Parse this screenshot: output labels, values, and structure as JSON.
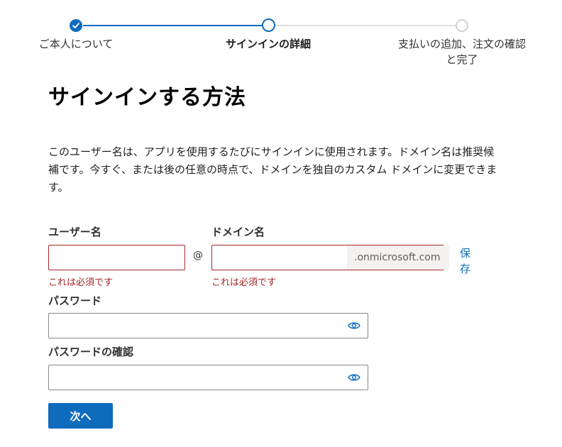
{
  "stepper": {
    "steps": [
      {
        "label": "ご本人について",
        "state": "completed"
      },
      {
        "label": "サインインの詳細",
        "state": "current"
      },
      {
        "label": "支払いの追加、注文の確認と完了",
        "state": "upcoming"
      }
    ]
  },
  "page": {
    "title": "サインインする方法",
    "description": "このユーザー名は、アプリを使用するたびにサインインに使用されます。ドメイン名は推奨候補です。今すぐ、または後の任意の時点で、ドメインを独自のカスタム ドメインに変更できます。"
  },
  "form": {
    "username": {
      "label": "ユーザー名",
      "value": "",
      "error": "これは必須です"
    },
    "at_symbol": "@",
    "domain": {
      "label": "ドメイン名",
      "value": "",
      "suffix": ".onmicrosoft.com",
      "error": "これは必須です",
      "save_label": "保存"
    },
    "password": {
      "label": "パスワード",
      "value": ""
    },
    "confirm_password": {
      "label": "パスワードの確認",
      "value": ""
    },
    "next_label": "次へ"
  },
  "colors": {
    "accent": "#0f6cbd",
    "error": "#a4262c",
    "upcoming": "#d2d0ce"
  },
  "icons": [
    "checkmark-icon",
    "eye-icon"
  ]
}
